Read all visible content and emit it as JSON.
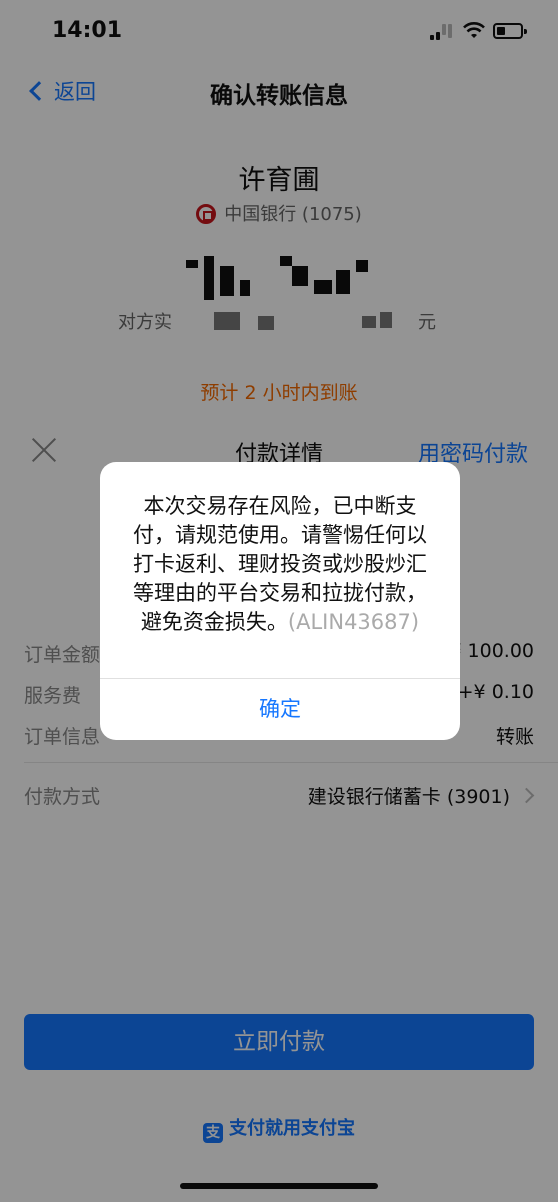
{
  "status": {
    "time": "14:01"
  },
  "nav": {
    "back_label": "返回",
    "title": "确认转账信息"
  },
  "payee": {
    "name": "许育圃",
    "bank": "中国银行 (1075)",
    "fee_prefix": "对方实",
    "fee_suffix": "元"
  },
  "eta": "预计 2 小时内到账",
  "sheet": {
    "title": "付款详情",
    "password_pay": "用密码付款",
    "rows": [
      {
        "label": "订单金额",
        "value": "¥ 100.00"
      },
      {
        "label": "服务费",
        "value": "+¥ 0.10"
      },
      {
        "label": "订单信息",
        "value": "转账"
      }
    ],
    "method": {
      "label": "付款方式",
      "value": "建设银行储蓄卡 (3901)"
    },
    "pay_button": "立即付款",
    "brand": "支付就用支付宝"
  },
  "alert": {
    "message": "本次交易存在风险，已中断支付，请规范使用。请警惕任何以打卡返利、理财投资或炒股炒汇等理由的平台交易和拉拢付款，避免资金损失。",
    "code": "(ALIN43687)",
    "ok_label": "确定"
  },
  "colors": {
    "accent": "#1677ff",
    "eta": "#f56a00",
    "bank_red": "#c8161d"
  }
}
